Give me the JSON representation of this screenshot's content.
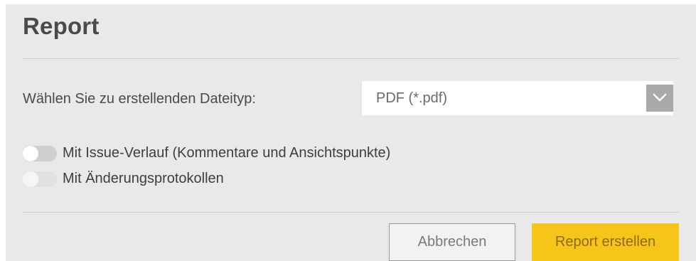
{
  "dialog": {
    "title": "Report"
  },
  "filetype": {
    "label": "Wählen Sie zu erstellenden Dateityp:",
    "selected_value": "PDF (*.pdf)",
    "arrow_icon": "chevron-down-icon"
  },
  "options": [
    {
      "label": "Mit Issue-Verlauf (Kommentare und Ansichtspunkte)",
      "enabled": false
    },
    {
      "label": "Mit Änderungsprotokollen",
      "enabled": false
    }
  ],
  "buttons": {
    "cancel_label": "Abbrechen",
    "create_label": "Report erstellen"
  },
  "colors": {
    "dialog_background": "#e9e9e9",
    "primary_button": "#f7c51a",
    "select_arrow_background": "#a9a9a9"
  }
}
